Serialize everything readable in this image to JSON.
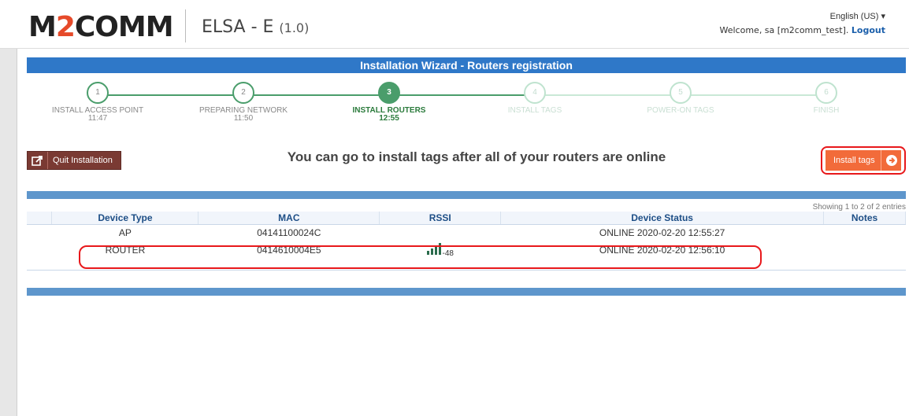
{
  "header": {
    "logo_main": "M",
    "logo_two": "2",
    "logo_rest": "COMM",
    "app_name": "ELSA - E",
    "app_version": "(1.0)",
    "language": "English (US) ▾",
    "welcome_text": "Welcome, sa [m2comm_test].",
    "logout_label": "Logout"
  },
  "wizard": {
    "title": "Installation Wizard - Routers registration",
    "steps": [
      {
        "num": "1",
        "label": "INSTALL ACCESS POINT",
        "time": "11:47",
        "state": "done"
      },
      {
        "num": "2",
        "label": "PREPARING NETWORK",
        "time": "11:50",
        "state": "done"
      },
      {
        "num": "3",
        "label": "INSTALL ROUTERS",
        "time": "12:55",
        "state": "active"
      },
      {
        "num": "4",
        "label": "INSTALL TAGS",
        "time": "",
        "state": "future"
      },
      {
        "num": "5",
        "label": "POWER-ON TAGS",
        "time": "",
        "state": "future"
      },
      {
        "num": "6",
        "label": "FINISH",
        "time": "",
        "state": "future"
      }
    ]
  },
  "actions": {
    "quit_label": "Quit Installation",
    "notice": "You can go to install tags after all of your routers are online",
    "install_tags_label": "Install tags"
  },
  "table": {
    "showing": "Showing 1 to 2 of 2 entries",
    "headers": [
      "",
      "Device Type",
      "MAC",
      "RSSI",
      "Device Status",
      "Notes"
    ],
    "rows": [
      {
        "type": "AP",
        "mac": "04141100024C",
        "rssi": "",
        "status": "ONLINE 2020-02-20 12:55:27",
        "notes": ""
      },
      {
        "type": "ROUTER",
        "mac": "0414610004E5",
        "rssi": "-48",
        "status": "ONLINE 2020-02-20 12:56:10",
        "notes": ""
      }
    ]
  },
  "colors": {
    "brand_red": "#e64a2a",
    "title_blue": "#2f78c8",
    "step_green": "#4a9d6b",
    "quit_brown": "#7a3a33",
    "install_orange": "#f26b3a",
    "highlight_red": "#e8181b"
  }
}
